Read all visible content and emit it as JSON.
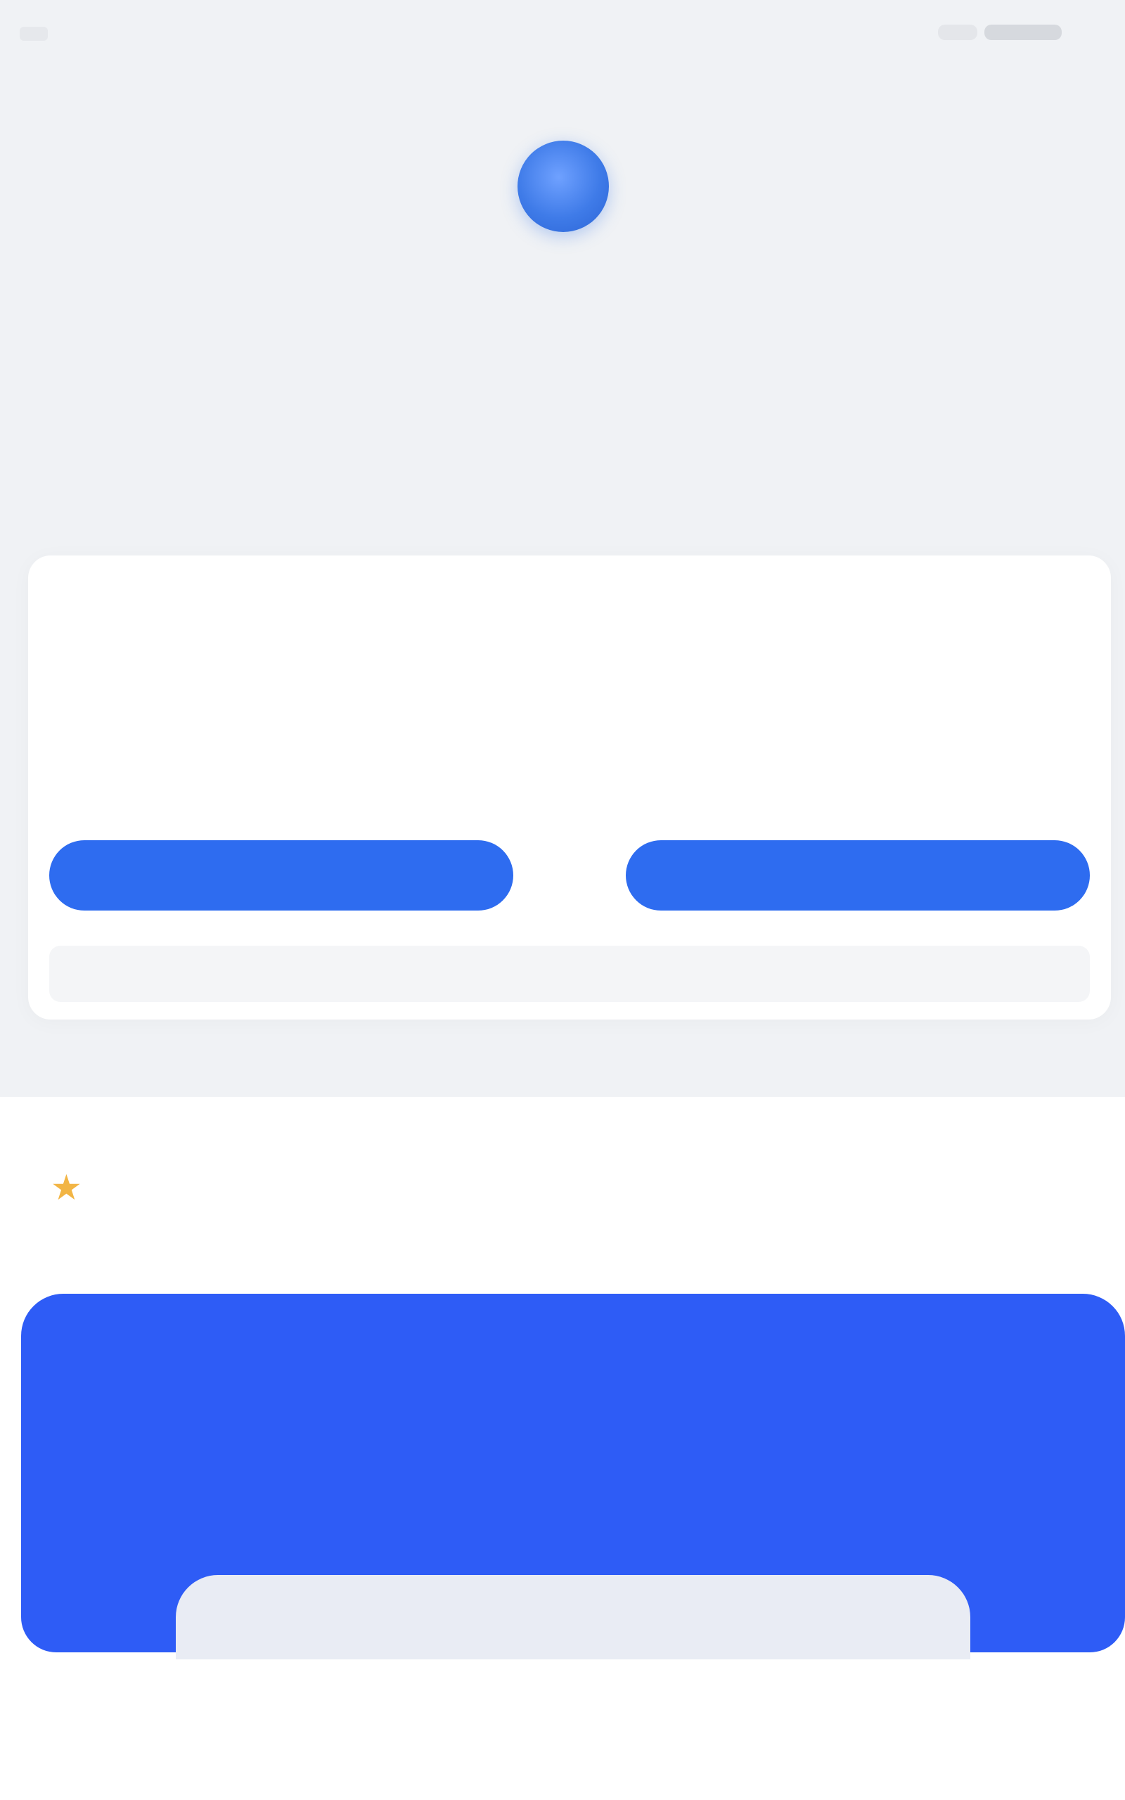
{
  "status_bar": {
    "time": "",
    "indicators": ""
  },
  "brand": {
    "logo_caption": "",
    "app_name": "",
    "subtitle": ""
  },
  "login_card": {
    "title": "",
    "description": "",
    "login_button": "",
    "register_button": "",
    "footer_link": ""
  },
  "divider": {
    "text": ""
  },
  "features": {
    "title": "",
    "subtitle": "",
    "icon": "star-icon"
  },
  "promo": {
    "title": "",
    "subtitle": "",
    "tag": ""
  },
  "bottom": {
    "label": ""
  },
  "colors": {
    "primary": "#2e6cf0",
    "promo": "#2e5cf6",
    "background": "#f0f2f5",
    "accent_star": "#f2b545"
  }
}
